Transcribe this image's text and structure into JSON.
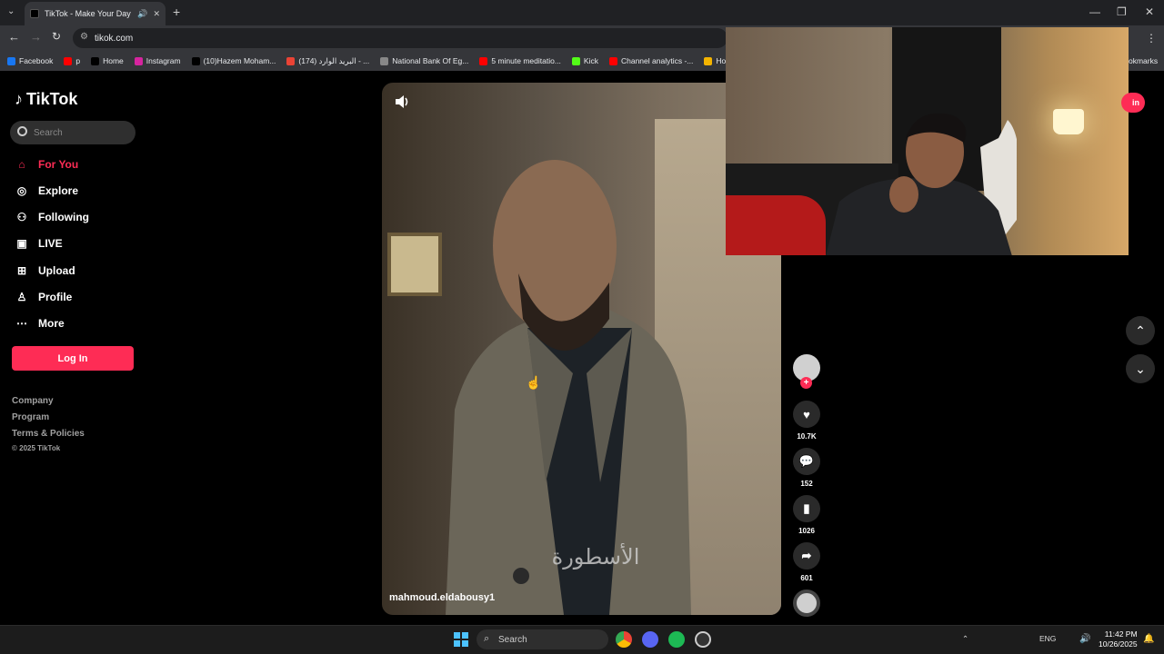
{
  "browser": {
    "tab_title": "TikTok - Make Your Day",
    "url": "tikok.com",
    "bookmarks": [
      {
        "label": "Facebook",
        "color": "#1877f2"
      },
      {
        "label": "p",
        "color": "#ff0000"
      },
      {
        "label": "Home",
        "color": "#000000"
      },
      {
        "label": "Instagram",
        "color": "#d6249f"
      },
      {
        "label": "(10)Hazem Moham...",
        "color": "#000000"
      },
      {
        "label": "(174) البريد الوارد - ...",
        "color": "#ea4335"
      },
      {
        "label": "National Bank Of Eg...",
        "color": "#888888"
      },
      {
        "label": "5 minute meditatio...",
        "color": "#ff0000"
      },
      {
        "label": "Kick",
        "color": "#53fc18"
      },
      {
        "label": "Channel analytics -...",
        "color": "#ff0000"
      },
      {
        "label": "Home",
        "color": "#f4b400"
      }
    ],
    "bookmarks_overflow": "okmarks"
  },
  "sidebar": {
    "logo_text": "TikTok",
    "search_placeholder": "Search",
    "nav": [
      {
        "label": "For You",
        "icon": "home-icon",
        "active": true
      },
      {
        "label": "Explore",
        "icon": "compass-icon",
        "active": false
      },
      {
        "label": "Following",
        "icon": "following-icon",
        "active": false
      },
      {
        "label": "LIVE",
        "icon": "live-icon",
        "active": false
      },
      {
        "label": "Upload",
        "icon": "upload-icon",
        "active": false
      },
      {
        "label": "Profile",
        "icon": "profile-icon",
        "active": false
      },
      {
        "label": "More",
        "icon": "more-icon",
        "active": false
      }
    ],
    "login_label": "Log In",
    "footer": [
      "Company",
      "Program",
      "Terms & Policies"
    ],
    "copyright": "© 2025 TikTok"
  },
  "video": {
    "username": "mahmoud.eldabousy1",
    "caption_overlay": "الأسطورة"
  },
  "actions": {
    "likes": "10.7K",
    "comments": "152",
    "saves": "1026",
    "shares": "601"
  },
  "header": {
    "signin_fragment": "in"
  },
  "taskbar": {
    "search_placeholder": "Search",
    "lang": "ENG",
    "time": "11:42 PM",
    "date": "10/26/2025"
  },
  "colors": {
    "accent": "#fe2c55"
  }
}
